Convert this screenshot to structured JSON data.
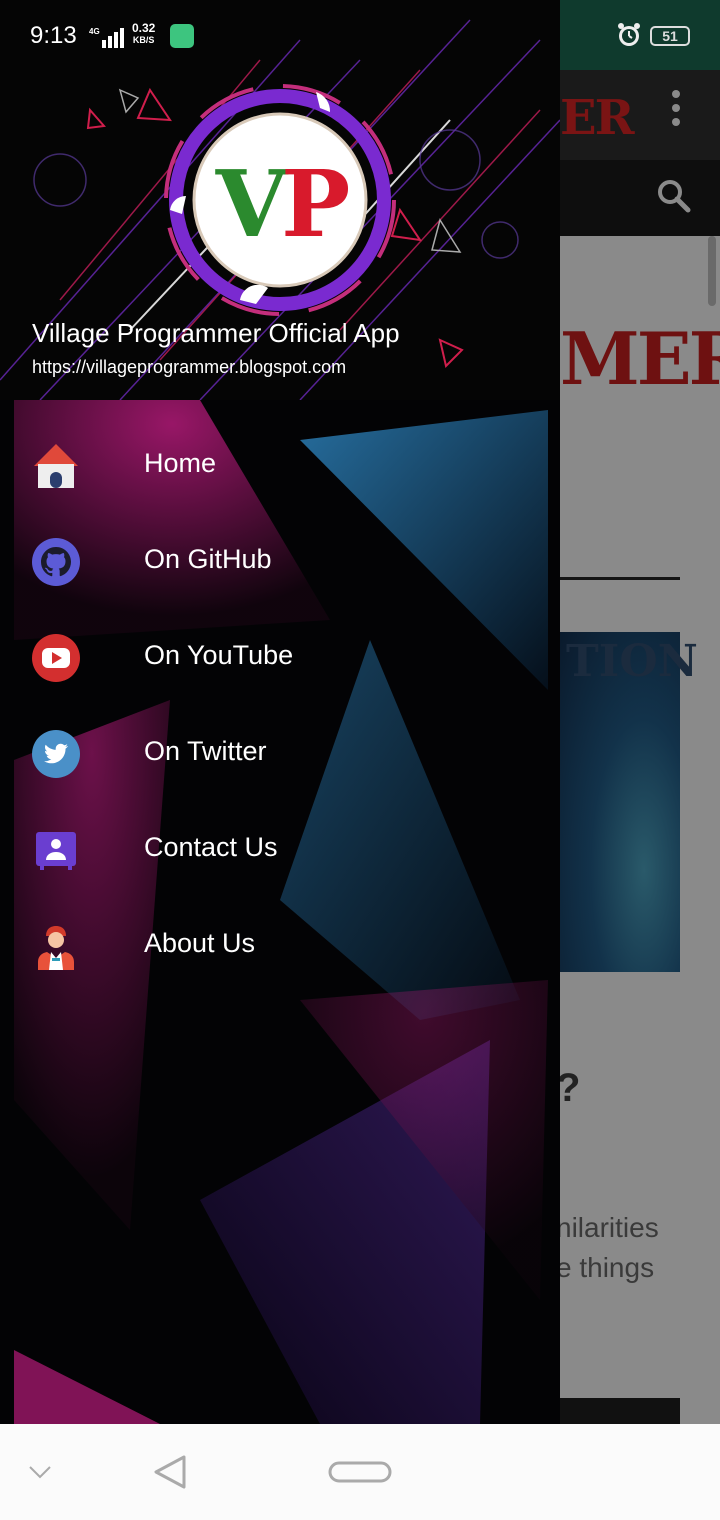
{
  "status_bar": {
    "time": "9:13",
    "network": "4G",
    "speed_value": "0.32",
    "speed_unit": "KB/S",
    "battery": "51"
  },
  "background": {
    "toolbar_logo_fragment": "ER",
    "content_logo_fragment": "MER",
    "image_text_fragment": "TION",
    "heading_fragment": "?",
    "text_line1": "nilarities",
    "text_line2": "e things"
  },
  "drawer": {
    "title": "Village Programmer Official App",
    "url": "https://villageprogrammer.blogspot.com",
    "logo_text": "VP",
    "items": [
      {
        "label": "Home",
        "icon": "home-icon"
      },
      {
        "label": "On GitHub",
        "icon": "github-icon"
      },
      {
        "label": "On YouTube",
        "icon": "youtube-icon"
      },
      {
        "label": "On Twitter",
        "icon": "twitter-icon"
      },
      {
        "label": "Contact Us",
        "icon": "contact-icon"
      },
      {
        "label": "About Us",
        "icon": "person-icon"
      }
    ]
  },
  "colors": {
    "accent_red": "#d32f2f",
    "github_purple": "#5c5bd6",
    "twitter_blue": "#4a90c8",
    "contact_purple": "#6a3ed0",
    "statusbar_green": "#0f3a2d"
  }
}
